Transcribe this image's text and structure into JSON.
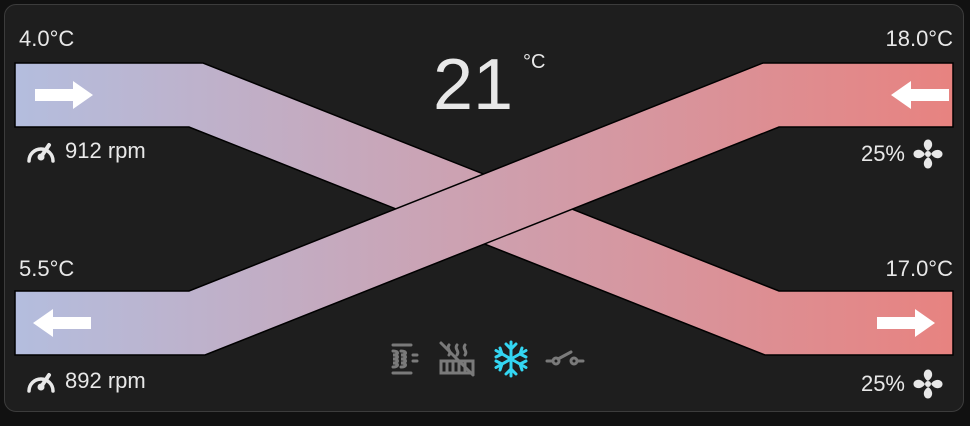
{
  "outdoor_air": {
    "temperature": "4.0°C",
    "fan_speed": "912 rpm"
  },
  "exhaust_air": {
    "temperature": "5.5°C",
    "fan_speed": "892 rpm"
  },
  "extract_air": {
    "temperature": "18.0°C",
    "fan_level": "25%"
  },
  "supply_air": {
    "temperature": "17.0°C",
    "fan_level": "25%"
  },
  "target": {
    "temperature": "21",
    "unit": "°C"
  },
  "status_icons": [
    {
      "name": "filter-icon",
      "active": false
    },
    {
      "name": "heater-off-icon",
      "active": false
    },
    {
      "name": "snowflake-icon",
      "active": true
    },
    {
      "name": "bypass-valve-icon",
      "active": false
    }
  ],
  "colors": {
    "cold": "#b3bedf",
    "warm": "#e8827f",
    "active_icon": "#33d6f2",
    "inactive_icon": "#7a7a7a"
  }
}
